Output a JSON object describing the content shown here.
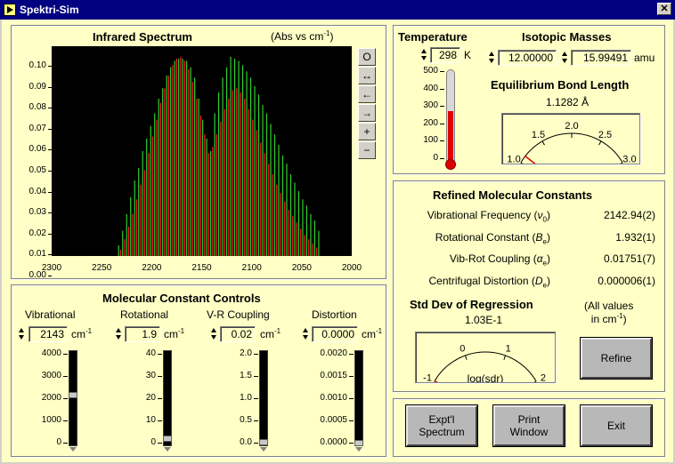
{
  "window": {
    "title": "Spektri-Sim",
    "close": "✕"
  },
  "spectrum": {
    "title": "Infrared Spectrum",
    "units_prefix": "(Abs vs cm",
    "units_sup": "-1",
    "units_suffix": ")",
    "tools": [
      "O",
      "↔",
      "←",
      "→",
      "+",
      "−"
    ]
  },
  "chart_data": {
    "type": "bar",
    "title": "Infrared Spectrum",
    "xlabel": "",
    "ylabel": "",
    "xlim": [
      2300,
      2000
    ],
    "ylim": [
      0,
      0.1
    ],
    "x_ticks": [
      "2300",
      "2250",
      "2200",
      "2150",
      "2100",
      "2050",
      "2000"
    ],
    "y_ticks": [
      "0.00",
      "0.01",
      "0.02",
      "0.03",
      "0.04",
      "0.05",
      "0.06",
      "0.07",
      "0.08",
      "0.09",
      "0.10"
    ],
    "series": [
      {
        "color": "#30d030",
        "x": [
          2233,
          2229,
          2225,
          2221,
          2217,
          2213,
          2209,
          2205,
          2201,
          2197,
          2193,
          2189,
          2185,
          2181,
          2177,
          2173,
          2169,
          2165,
          2161,
          2157,
          2153,
          2149,
          2145,
          2141,
          2137,
          2133,
          2129,
          2125,
          2121,
          2117,
          2113,
          2109,
          2105,
          2101,
          2097,
          2093,
          2089,
          2085,
          2081,
          2077,
          2073,
          2069,
          2065,
          2061,
          2057,
          2053,
          2049,
          2045,
          2041,
          2037,
          2033
        ],
        "values": [
          0.005,
          0.012,
          0.02,
          0.028,
          0.036,
          0.042,
          0.05,
          0.056,
          0.062,
          0.068,
          0.075,
          0.08,
          0.086,
          0.09,
          0.093,
          0.094,
          0.094,
          0.093,
          0.09,
          0.085,
          0.075,
          0.065,
          0.056,
          0.05,
          0.068,
          0.078,
          0.085,
          0.09,
          0.095,
          0.094,
          0.093,
          0.091,
          0.088,
          0.085,
          0.081,
          0.077,
          0.072,
          0.068,
          0.063,
          0.058,
          0.053,
          0.048,
          0.044,
          0.039,
          0.035,
          0.031,
          0.027,
          0.024,
          0.02,
          0.017,
          0.012
        ]
      },
      {
        "color": "#ff2020",
        "x": [
          2231,
          2227,
          2223,
          2219,
          2215,
          2211,
          2207,
          2203,
          2199,
          2195,
          2191,
          2187,
          2183,
          2179,
          2175,
          2171,
          2167,
          2163,
          2159,
          2155,
          2151,
          2147,
          2143,
          2139,
          2135,
          2131,
          2127,
          2123,
          2119,
          2115,
          2111,
          2107,
          2103,
          2099,
          2095,
          2091,
          2087,
          2083,
          2079,
          2075,
          2071,
          2067,
          2063,
          2059,
          2055,
          2051,
          2047,
          2043,
          2039,
          2035
        ],
        "values": [
          0.003,
          0.008,
          0.014,
          0.02,
          0.027,
          0.034,
          0.041,
          0.049,
          0.057,
          0.065,
          0.073,
          0.08,
          0.086,
          0.091,
          0.094,
          0.095,
          0.093,
          0.089,
          0.083,
          0.075,
          0.067,
          0.058,
          0.049,
          0.052,
          0.058,
          0.064,
          0.07,
          0.075,
          0.079,
          0.08,
          0.078,
          0.075,
          0.07,
          0.065,
          0.06,
          0.054,
          0.049,
          0.044,
          0.039,
          0.034,
          0.03,
          0.026,
          0.022,
          0.019,
          0.016,
          0.013,
          0.01,
          0.008,
          0.006,
          0.004
        ]
      }
    ]
  },
  "temperature": {
    "label": "Temperature",
    "value": "298",
    "unit": "K",
    "scale": [
      "500",
      "400",
      "300",
      "200",
      "100",
      "0"
    ],
    "level": 298,
    "max": 500
  },
  "isotopes": {
    "label": "Isotopic Masses",
    "m1": "12.00000",
    "m2": "15.99491",
    "unit": "amu"
  },
  "bond": {
    "label": "Equilibrium Bond Length",
    "value": "1.1282 Å",
    "scale": [
      "1.0",
      "1.5",
      "2.0",
      "2.5",
      "3.0"
    ],
    "needle": 1.1282
  },
  "refined": {
    "title": "Refined Molecular Constants",
    "rows": [
      {
        "label": "Vibrational Frequency (",
        "sym": "ν",
        "sub": "0",
        "value": "2142.94(2)"
      },
      {
        "label": "Rotational Constant (",
        "sym": "B",
        "sub": "e",
        "value": "1.932(1)"
      },
      {
        "label": "Vib-Rot Coupling (",
        "sym": "α",
        "sub": "e",
        "value": "0.01751(7)"
      },
      {
        "label": "Centrifugal Distortion (",
        "sym": "D",
        "sub": "e",
        "value": "0.000006(1)"
      }
    ],
    "close_paren": ")",
    "stddev_label": "Std Dev of Regression",
    "stddev_value": "1.03E-1",
    "units_note_1": "(All values",
    "units_note_2": "in cm",
    "units_note_sup": "-1",
    "units_note_3": ")",
    "gauge_scale": [
      "-1",
      "0",
      "1",
      "2"
    ],
    "gauge_label": "log(sdr)",
    "log_sdr": -0.99,
    "refine": "Refine"
  },
  "controls": {
    "title": "Molecular Constant Controls",
    "unit": "cm",
    "unit_sup": "-1",
    "items": [
      {
        "label": "Vibrational",
        "value": "2143",
        "scale": [
          "4000",
          "3000",
          "2000",
          "1000",
          "0"
        ],
        "level": 2143,
        "max": 4000
      },
      {
        "label": "Rotational",
        "value": "1.9",
        "scale": [
          "40",
          "30",
          "20",
          "10",
          "0"
        ],
        "level": 1.9,
        "max": 40
      },
      {
        "label": "V-R Coupling",
        "value": "0.02",
        "scale": [
          "2.0",
          "1.5",
          "1.0",
          "0.5",
          "0.0"
        ],
        "level": 0.02,
        "max": 2
      },
      {
        "label": "Distortion",
        "value": "0.0000",
        "scale": [
          "0.0020",
          "0.0015",
          "0.0010",
          "0.0005",
          "0.0000"
        ],
        "level": 0,
        "max": 0.002
      }
    ]
  },
  "buttons": {
    "expt": "Expt'l\nSpectrum",
    "print": "Print\nWindow",
    "exit": "Exit"
  }
}
